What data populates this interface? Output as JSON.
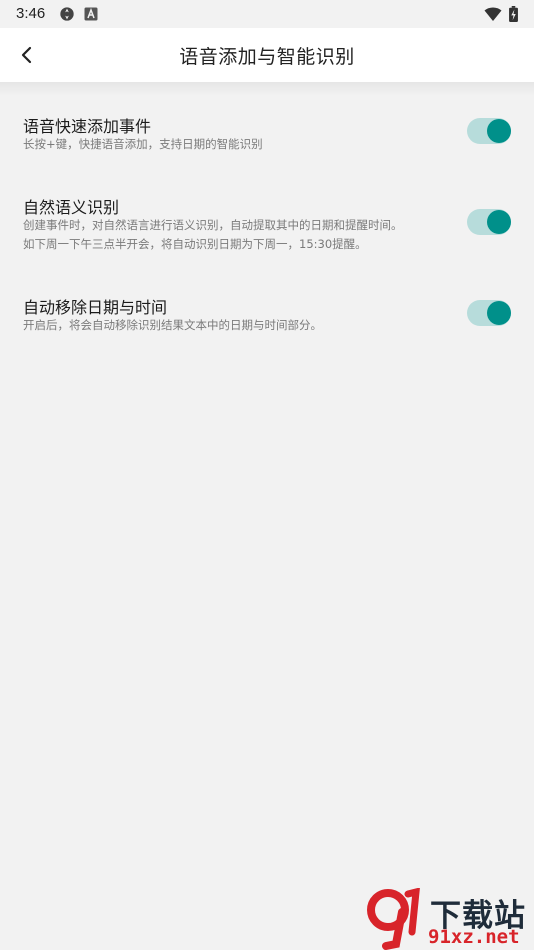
{
  "status_bar": {
    "time": "3:46",
    "icons_left": [
      "sync-icon",
      "keyboard-a-icon"
    ],
    "icons_right": [
      "wifi-icon",
      "battery-charging-icon"
    ]
  },
  "header": {
    "title": "语音添加与智能识别",
    "back_icon": "back-arrow-icon"
  },
  "settings": [
    {
      "title": "语音快速添加事件",
      "desc_lines": [
        "长按+键，快捷语音添加，支持日期的智能识别"
      ],
      "enabled": true
    },
    {
      "title": "自然语义识别",
      "desc_lines": [
        "创建事件时，对自然语言进行语义识别，自动提取其中的日期和提醒时间。",
        "如下周一下午三点半开会，将自动识别日期为下周一，15:30提醒。"
      ],
      "enabled": true
    },
    {
      "title": "自动移除日期与时间",
      "desc_lines": [
        "开启后，将会自动移除识别结果文本中的日期与时间部分。"
      ],
      "enabled": true
    }
  ],
  "watermark": {
    "logo_text": "下载站",
    "domain": "91xz.net"
  },
  "colors": {
    "accent": "#00908a",
    "toggle_track": "#b7dcdb",
    "background": "#f2f2f2"
  }
}
